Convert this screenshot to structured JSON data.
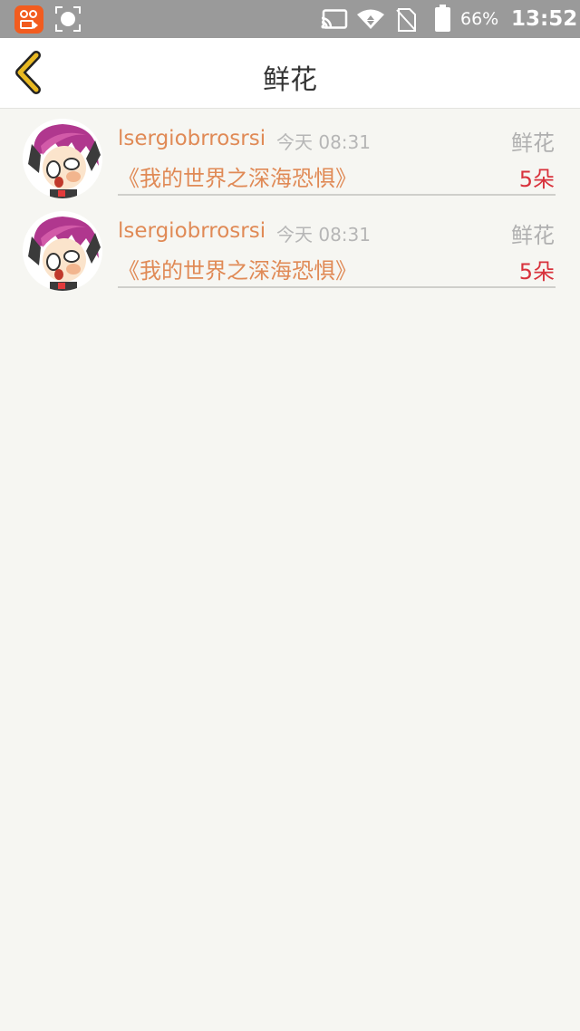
{
  "status_bar": {
    "battery": "66%",
    "time": "13:52",
    "icons": [
      "app-badge-icon",
      "screenshot-icon",
      "cast-icon",
      "wifi-icon",
      "no-sim-icon",
      "battery-icon"
    ]
  },
  "header": {
    "title": "鲜花",
    "back_icon": "chevron-left-icon"
  },
  "colors": {
    "accent": "#e08a56",
    "count": "#d8323c",
    "back": "#e9b922"
  },
  "items": [
    {
      "username": "lsergiobrrosrsi",
      "time": "今天 08:31",
      "gift": "鲜花",
      "book": "《我的世界之深海恐惧》",
      "count": "5朵"
    },
    {
      "username": "lsergiobrrosrsi",
      "time": "今天 08:31",
      "gift": "鲜花",
      "book": "《我的世界之深海恐惧》",
      "count": "5朵"
    }
  ]
}
